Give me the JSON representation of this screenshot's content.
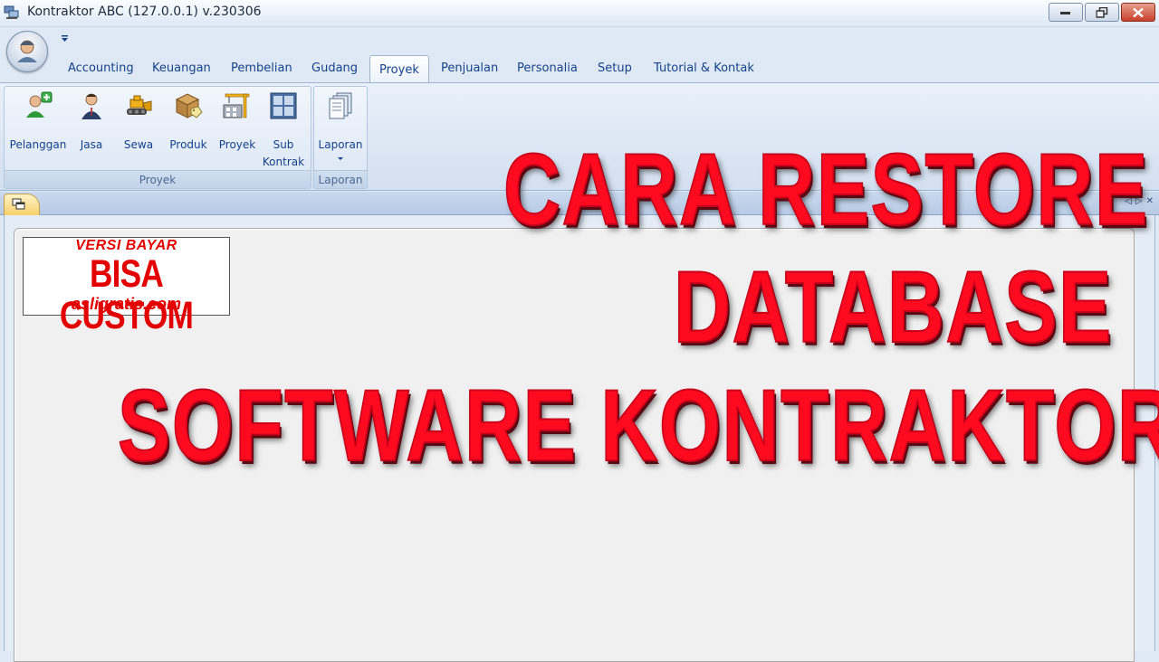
{
  "window": {
    "title": "Kontraktor ABC (127.0.0.1) v.230306"
  },
  "ribbon_tabs": [
    "Accounting",
    "Keuangan",
    "Pembelian",
    "Gudang",
    "Proyek",
    "Penjualan",
    "Personalia",
    "Setup",
    "Tutorial & Kontak"
  ],
  "active_tab": "Proyek",
  "groups": {
    "proyek": {
      "label": "Proyek",
      "buttons": {
        "pelanggan": "Pelanggan",
        "jasa": "Jasa",
        "sewa": "Sewa",
        "produk": "Produk",
        "proyek": "Proyek",
        "sub_kontrak_1": "Sub",
        "sub_kontrak_2": "Kontrak"
      }
    },
    "laporan": {
      "label": "Laporan",
      "buttons": {
        "laporan": "Laporan"
      }
    }
  },
  "badge": {
    "line1": "VERSI BAYAR",
    "line2": "BISA CUSTOM",
    "line3": "asligratis.com"
  },
  "overlay": {
    "line1": "CARA RESTORE",
    "line2": "DATABASE",
    "line3": "SOFTWARE KONTRAKTOR"
  },
  "colors": {
    "overlay_red": "#ff0a1f",
    "ribbon_text": "#15428b",
    "badge_red": "#e30000"
  }
}
